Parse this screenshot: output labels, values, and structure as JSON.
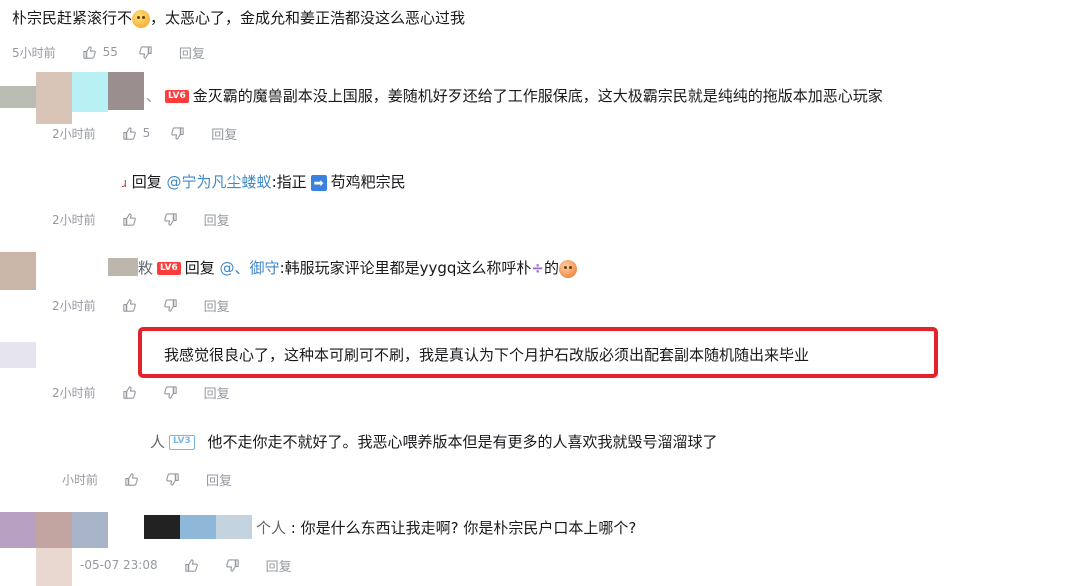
{
  "comments": [
    {
      "text_before": "朴宗民赶紧滚行不",
      "text_after": "，太恶心了，金成允和姜正浩都没这么恶心过我",
      "time": "5小时前",
      "likes": "55",
      "reply": "回复"
    },
    {
      "level": "LV6",
      "text": "金灭霸的魔兽副本没上国服，姜随机好歹还给了工作服保底，这大极霸宗民就是纯纯的拖版本加恶心玩家",
      "time": "2小时前",
      "likes": "5",
      "reply": "回复"
    },
    {
      "reply_prefix": "回复",
      "mention": "@宁为凡尘蝼蚁",
      "text_before": ":指正",
      "text_after": "苟鸡粑宗民",
      "time": "2小时前",
      "reply": "回复"
    },
    {
      "name_tail": "敉",
      "level": "LV6",
      "reply_prefix": "回复",
      "mention": "@、御守",
      "text_before": ":韩服玩家评论里都是yygq这么称呼朴",
      "divide": "÷",
      "text_after": "的",
      "time": "2小时前",
      "reply": "回复"
    },
    {
      "text": "我感觉很良心了，这种本可刷可不刷，我是真认为下个月护石改版必须出配套副本随机随出来毕业",
      "time": "2小时前",
      "reply": "回复"
    },
    {
      "name_tail": "人",
      "level": "LV3",
      "text": "他不走你走不就好了。我恶心喂养版本但是有更多的人喜欢我就毁号溜溜球了",
      "time": "小时前",
      "reply": "回复"
    },
    {
      "name_tail": "个人",
      "text": ": 你是什么东西让我走啊? 你是朴宗民户口本上哪个?",
      "time": "-05-07 23:08",
      "reply": "回复"
    }
  ],
  "colors": {
    "highlight": "#e2232b",
    "mention": "#3f88c5",
    "meta": "#9499a0"
  }
}
